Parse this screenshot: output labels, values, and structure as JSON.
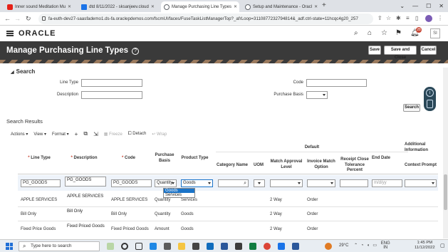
{
  "browser": {
    "tabs": [
      {
        "title": "Inner sound Meditation Mu",
        "color": "#e62117",
        "active": false
      },
      {
        "title": "dtd 8/11/2022 - sksanjeev.cloud",
        "color": "#1a73e8",
        "active": false
      },
      {
        "title": "Manage Purchasing Line Types",
        "color": "#5f6368",
        "active": true
      },
      {
        "title": "Setup and Maintenance - Oracl",
        "color": "#5f6368",
        "active": false
      }
    ],
    "new_tab": "+",
    "url": "fa-euth-dev27-saasfademo1.ds-fa.oraclepdemos.com/fscmUI/faces/FuseTaskListManagerTop?_afrLoop=3110877232794814&_adf.ctrl-state=11hcqc4g20_257"
  },
  "app": {
    "brand": "ORACLE",
    "notification_count": "28",
    "avatar_initials": "SI"
  },
  "page": {
    "title": "Manage Purchasing Line Types",
    "help": "?",
    "buttons": {
      "save": "Save",
      "save_close": "Save and Close",
      "cancel": "Cancel"
    }
  },
  "search": {
    "header": "Search",
    "line_type_label": "Line Type",
    "description_label": "Description",
    "code_label": "Code",
    "purchase_basis_label": "Purchase Basis",
    "search_button": "Search"
  },
  "results": {
    "title": "Search Results",
    "toolbar": {
      "actions": "Actions",
      "view": "View",
      "format": "Format",
      "freeze": "Freeze",
      "detach": "Detach",
      "wrap": "Wrap"
    },
    "headers": {
      "line_type": "Line Type",
      "description": "Description",
      "code": "Code",
      "purchase_basis": "Purchase Basis",
      "product_type": "Product Type",
      "default_group": "Default",
      "category_name": "Category Name",
      "uom": "UOM",
      "match_approval_level": "Match Approval Level",
      "invoice_match_option": "Invoice Match Option",
      "receipt_close_tolerance": "Receipt Close Tolerance Percent",
      "end_date": "End Date",
      "additional_info": "Additional Information",
      "context_prompt": "Context Prompt"
    },
    "new_row": {
      "line_type": "PG_GOODS",
      "description": "PG_GOODS",
      "code": "PG_GOODS",
      "purchase_basis": "Quantity",
      "product_type": "Goods",
      "end_date_placeholder": "m/d/yy"
    },
    "product_type_options": [
      "Goods",
      "Services"
    ],
    "rows": [
      {
        "line_type": "APPLE SERVICES",
        "description": "APPLE SERVICES",
        "code": "APPLE SERVICES",
        "purchase_basis": "Quantity",
        "product_type": "Services",
        "match_approval_level": "2 Way",
        "invoice_match_option": "Order"
      },
      {
        "line_type": "Bill Only",
        "description": "Bill Only",
        "code": "Bill Only",
        "purchase_basis": "Quantity",
        "product_type": "Goods",
        "match_approval_level": "2 Way",
        "invoice_match_option": "Order"
      },
      {
        "line_type": "Fixed Price Goods",
        "description": "Fixed Priced Goods",
        "code": "Fixed Priced Goods",
        "purchase_basis": "Amount",
        "product_type": "Goods",
        "match_approval_level": "2 Way",
        "invoice_match_option": "Order"
      }
    ]
  },
  "taskbar": {
    "search_placeholder": "Type here to search",
    "weather": "29°C",
    "language": "ENG",
    "region": "IN",
    "time": "1:45 PM",
    "date": "11/12/2022"
  }
}
